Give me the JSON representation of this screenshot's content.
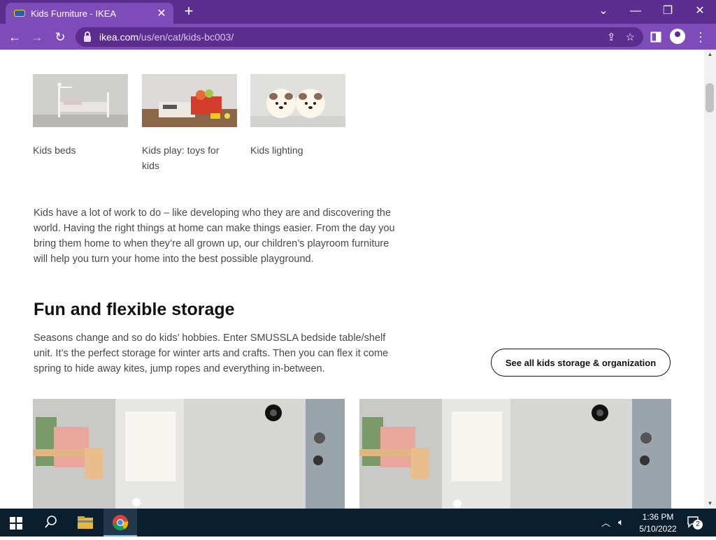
{
  "browser": {
    "tab_title": "Kids Furniture - IKEA",
    "tab_close": "✕",
    "new_tab": "+",
    "url_host": "ikea.com",
    "url_path": "/us/en/cat/kids-bc003/",
    "win_minimize": "—",
    "win_restore": "❐",
    "win_close": "✕",
    "win_dropdown": "⌄"
  },
  "categories": [
    {
      "label": "Kids beds"
    },
    {
      "label": "Kids play: toys for kids"
    },
    {
      "label": "Kids lighting"
    }
  ],
  "intro_text": "Kids have a lot of work to do – like developing who they are and discovering the world. Having the right things at home can make things easier. From the day you bring them home to when they’re all grown up, our children’s playroom furniture will help you turn your home into the best possible playground.",
  "storage": {
    "heading": "Fun and flexible storage",
    "text": "Seasons change and so do kids’ hobbies. Enter SMUSSLA bedside table/shelf unit. It’s the perfect storage for winter arts and crafts. Then you can flex it come spring to hide away kites, jump ropes and everything in-between.",
    "button_label": "See all kids storage & organization"
  },
  "taskbar": {
    "time": "1:36 PM",
    "date": "5/10/2022",
    "notification_count": "2"
  }
}
